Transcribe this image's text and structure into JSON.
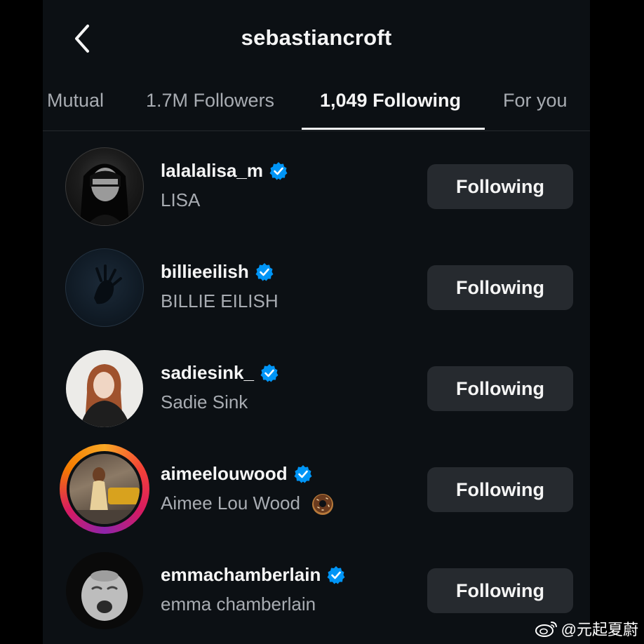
{
  "header": {
    "title": "sebastiancroft",
    "back_icon": "chevron-left-icon"
  },
  "tabs": [
    {
      "label": "Mutual",
      "active": false
    },
    {
      "label": "1.7M Followers",
      "active": false
    },
    {
      "label": "1,049 Following",
      "active": true
    },
    {
      "label": "For you",
      "active": false
    }
  ],
  "users": [
    {
      "username": "lalalalisa_m",
      "full_name": "LISA",
      "verified": true,
      "button": "Following"
    },
    {
      "username": "billieeilish",
      "full_name": "BILLIE EILISH",
      "verified": true,
      "button": "Following"
    },
    {
      "username": "sadiesink_",
      "full_name": "Sadie Sink",
      "verified": true,
      "button": "Following"
    },
    {
      "username": "aimeelouwood",
      "full_name": "Aimee Lou Wood",
      "full_name_emoji": "donut-emoji",
      "verified": true,
      "has_story": true,
      "button": "Following"
    },
    {
      "username": "emmachamberlain",
      "full_name": "emma chamberlain",
      "verified": true,
      "button": "Following"
    }
  ],
  "watermark": {
    "text": "@元起夏蔚",
    "icon": "weibo-logo"
  },
  "colors": {
    "background": "#0c1014",
    "verified": "#0095f6",
    "button_bg": "#262a2f",
    "secondary_text": "#a8acb2"
  }
}
